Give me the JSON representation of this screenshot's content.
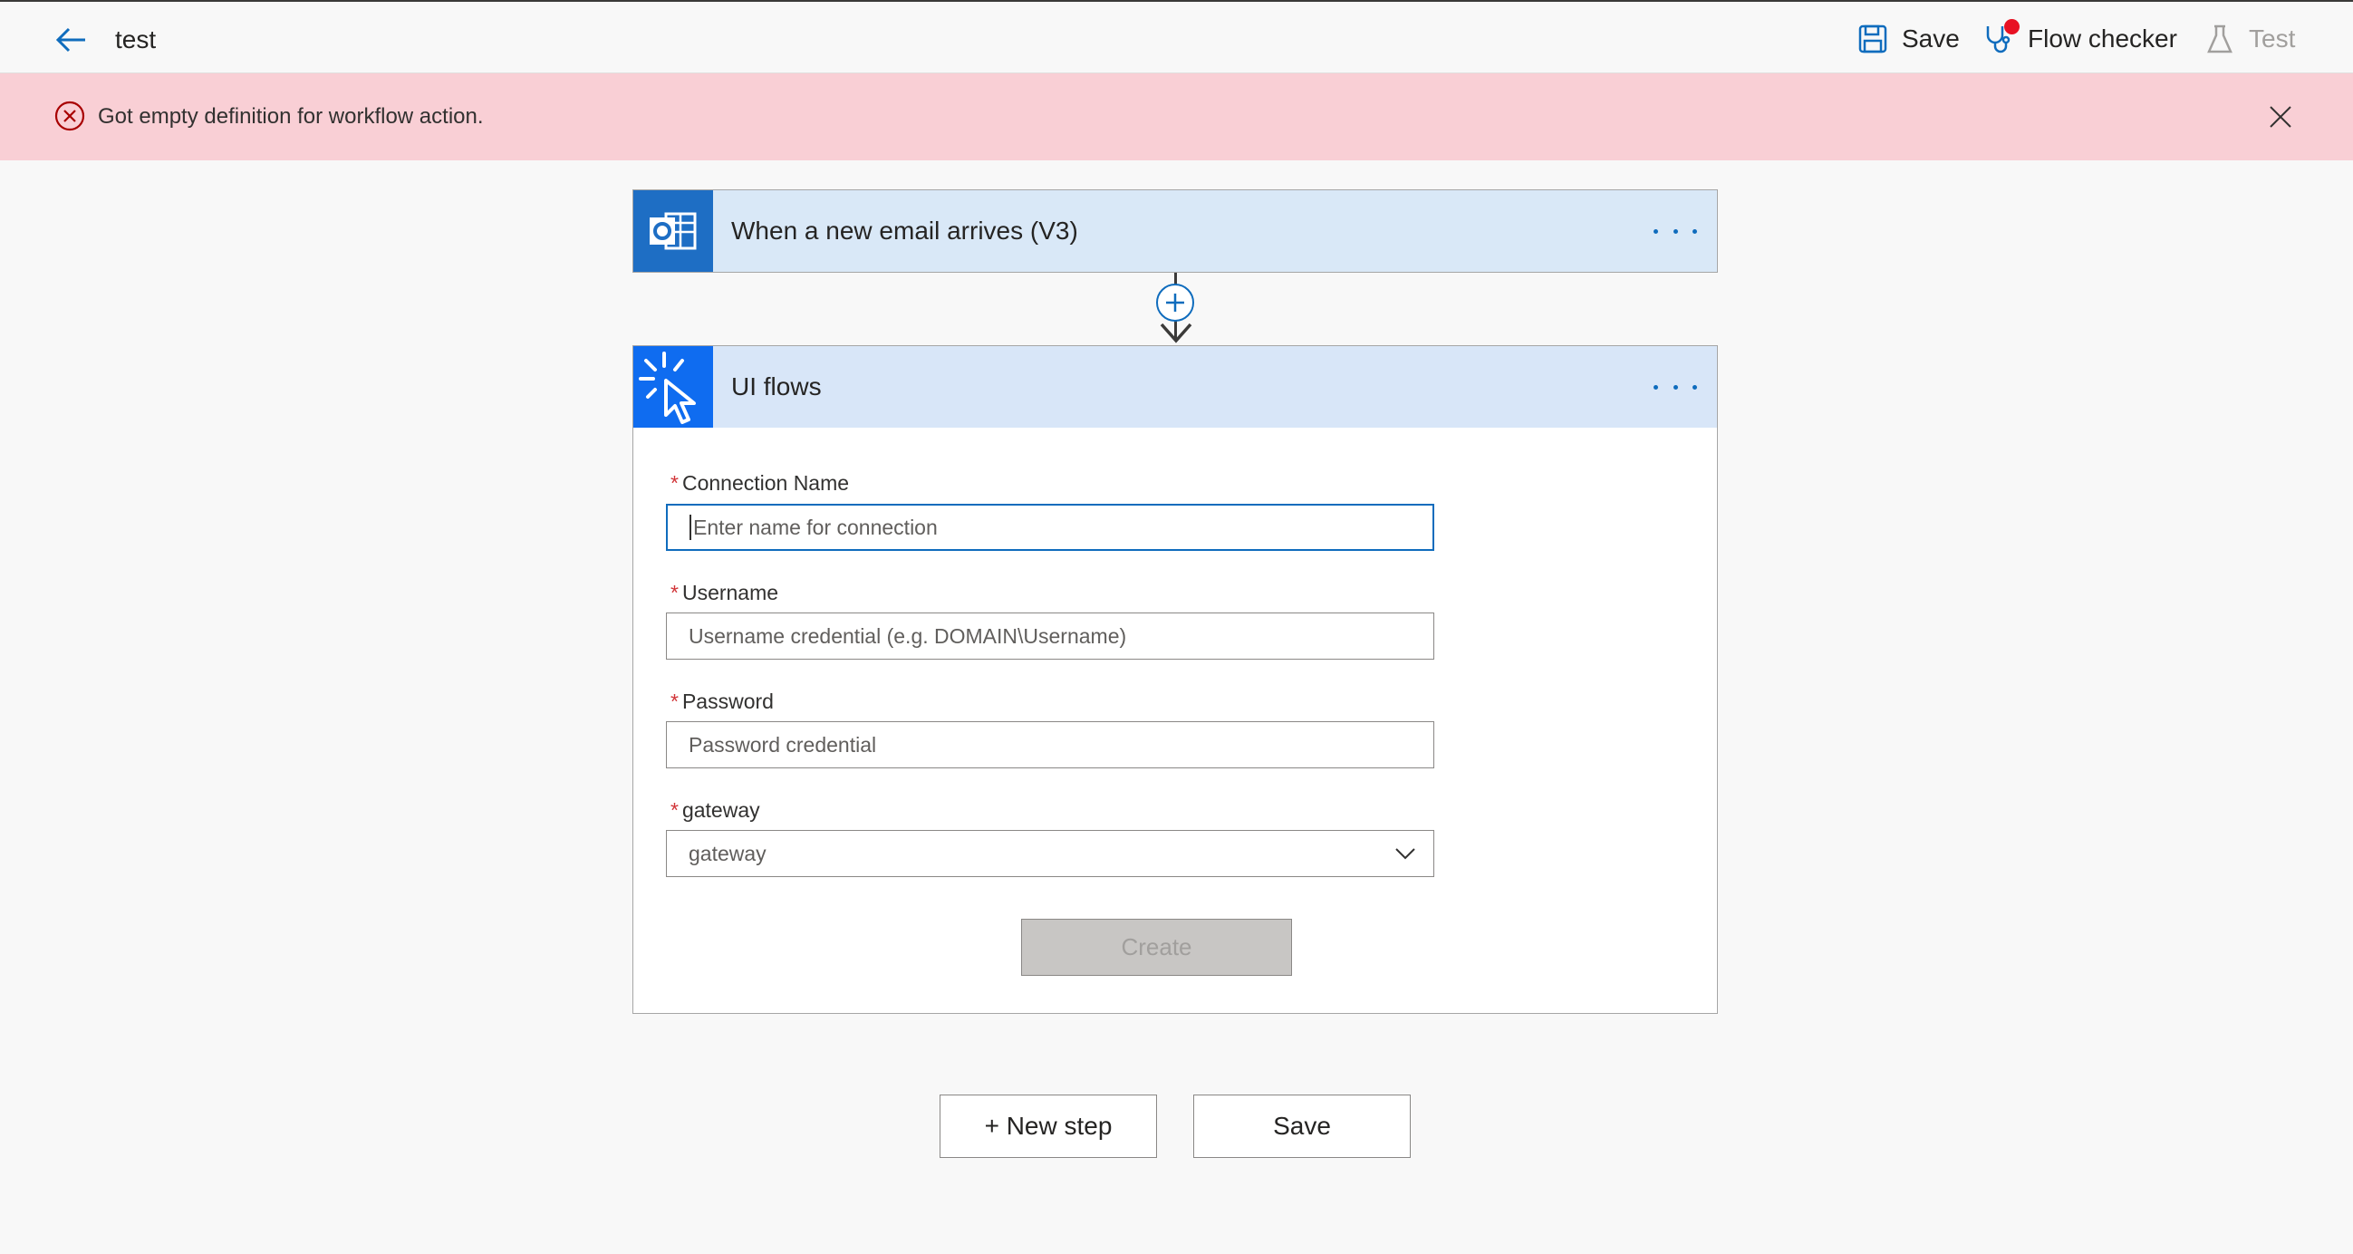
{
  "header": {
    "flow_name": "test",
    "save_label": "Save",
    "flow_checker_label": "Flow checker",
    "test_label": "Test",
    "accent_color": "#0f6cbd",
    "icons": [
      "back-arrow-icon",
      "save-icon",
      "stethoscope-icon",
      "beaker-icon"
    ]
  },
  "error_bar": {
    "message": "Got empty definition for workflow action.",
    "color": "#f9cfd5",
    "icons": [
      "error-circle-icon",
      "close-icon"
    ]
  },
  "trigger_card": {
    "title": "When a new email arrives (V3)",
    "icon": "outlook-icon"
  },
  "ui_flows_card": {
    "title": "UI flows",
    "icon": "cursor-click-icon",
    "fields": {
      "connection_name": {
        "label": "Connection Name",
        "placeholder": "Enter name for connection",
        "value": ""
      },
      "username": {
        "label": "Username",
        "placeholder": "Username credential (e.g. DOMAIN\\Username)",
        "value": ""
      },
      "password": {
        "label": "Password",
        "placeholder": "Password credential",
        "value": ""
      },
      "gateway": {
        "label": "gateway",
        "selected": "gateway"
      }
    },
    "create_label": "Create"
  },
  "footer": {
    "new_step_label": "+ New step",
    "save_label": "Save"
  }
}
